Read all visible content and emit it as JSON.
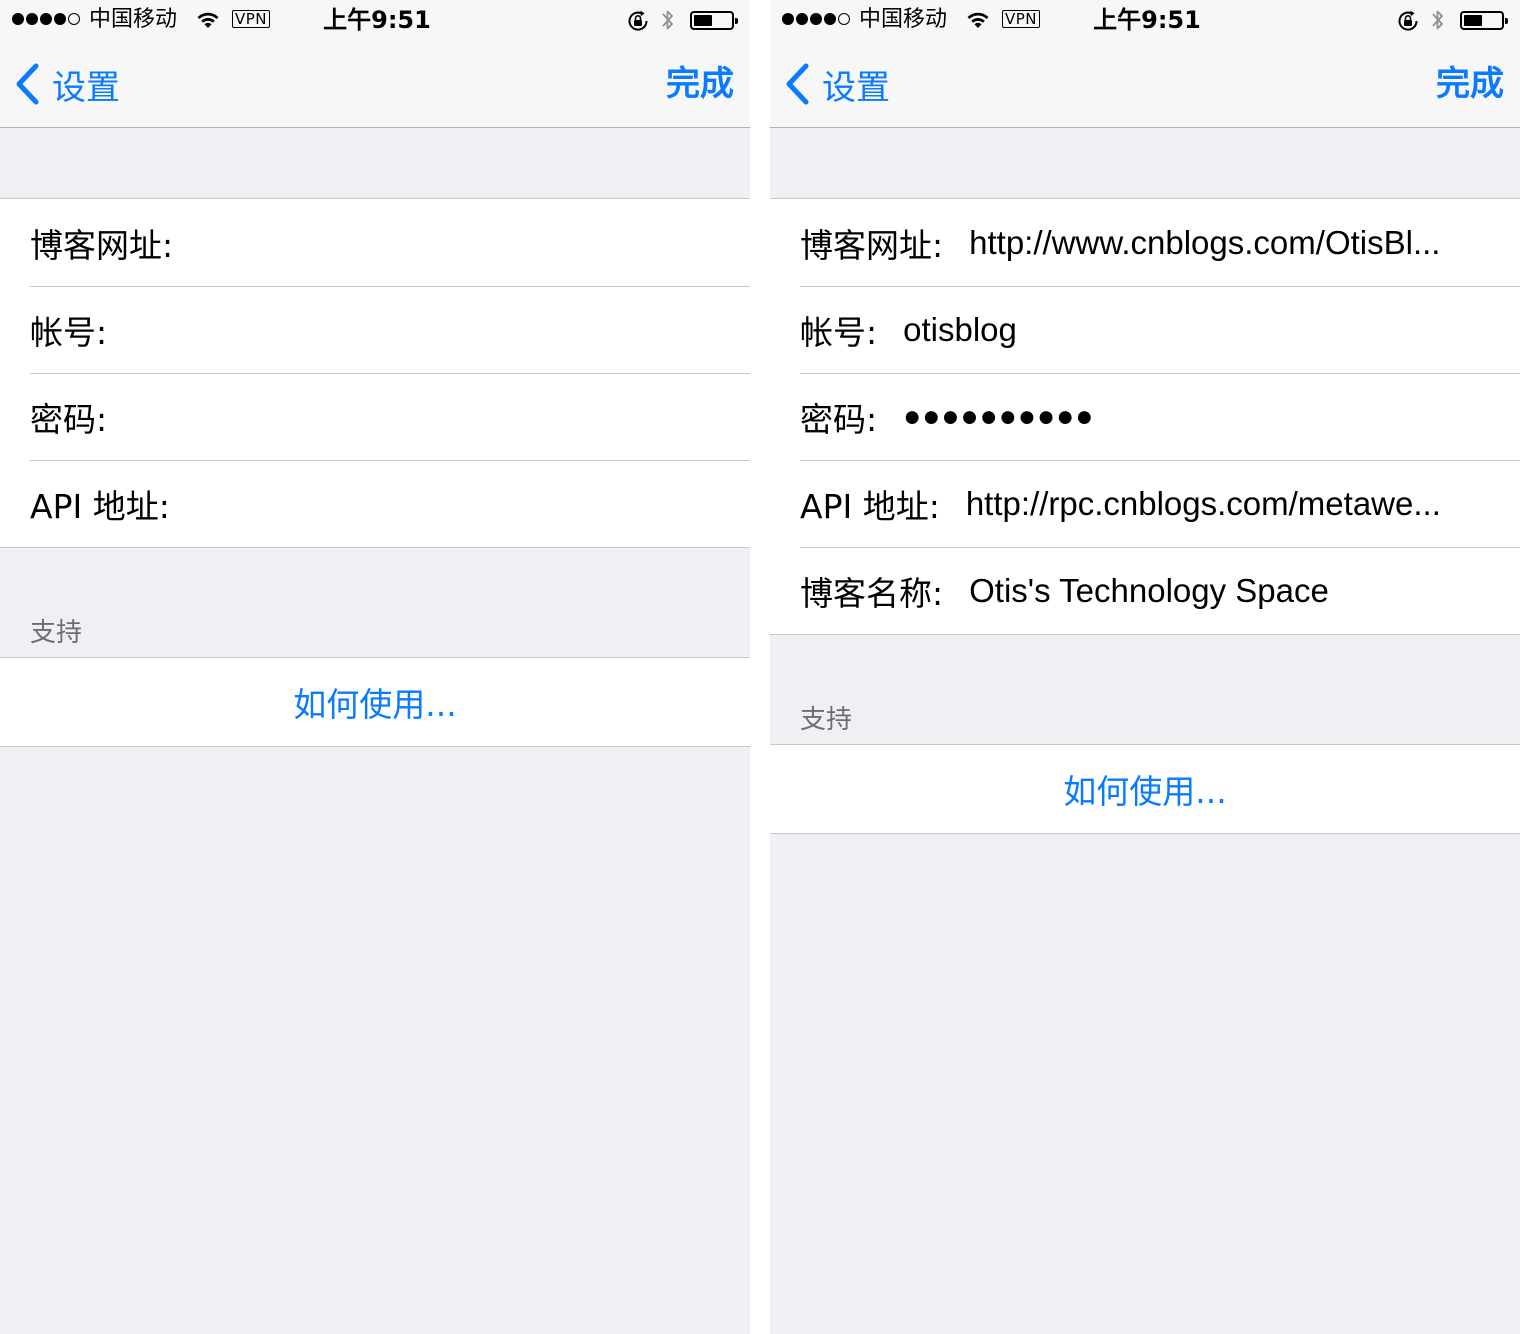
{
  "statusbar": {
    "carrier": "中国移动",
    "vpn": "VPN",
    "time": "上午9:51",
    "signal_icon": "signal-dots-icon",
    "wifi_icon": "wifi-icon",
    "rotation_lock_icon": "rotation-lock-icon",
    "bluetooth_icon": "bluetooth-icon",
    "battery_icon": "battery-icon",
    "battery_level": 0.5,
    "signal_bars": 4
  },
  "navbar": {
    "back_label": "设置",
    "done_label": "完成"
  },
  "colors": {
    "accent": "#0a7aff",
    "background": "#efeff4",
    "separator": "#c8c7cc",
    "header_text": "#6d6d72"
  },
  "screens": [
    {
      "fields": [
        {
          "label": "博客网址:",
          "value": ""
        },
        {
          "label": "帐号:",
          "value": ""
        },
        {
          "label": "密码:",
          "value": ""
        },
        {
          "label": "API 地址:",
          "value": ""
        }
      ],
      "support_header": "支持",
      "support_link": "如何使用..."
    },
    {
      "fields": [
        {
          "label": "博客网址:",
          "value": "http://www.cnblogs.com/OtisBl..."
        },
        {
          "label": "帐号:",
          "value": "otisblog"
        },
        {
          "label": "密码:",
          "value": "●●●●●●●●●●"
        },
        {
          "label": "API 地址:",
          "value": "http://rpc.cnblogs.com/metawe..."
        },
        {
          "label": "博客名称:",
          "value": "Otis's Technology Space"
        }
      ],
      "support_header": "支持",
      "support_link": "如何使用..."
    }
  ]
}
